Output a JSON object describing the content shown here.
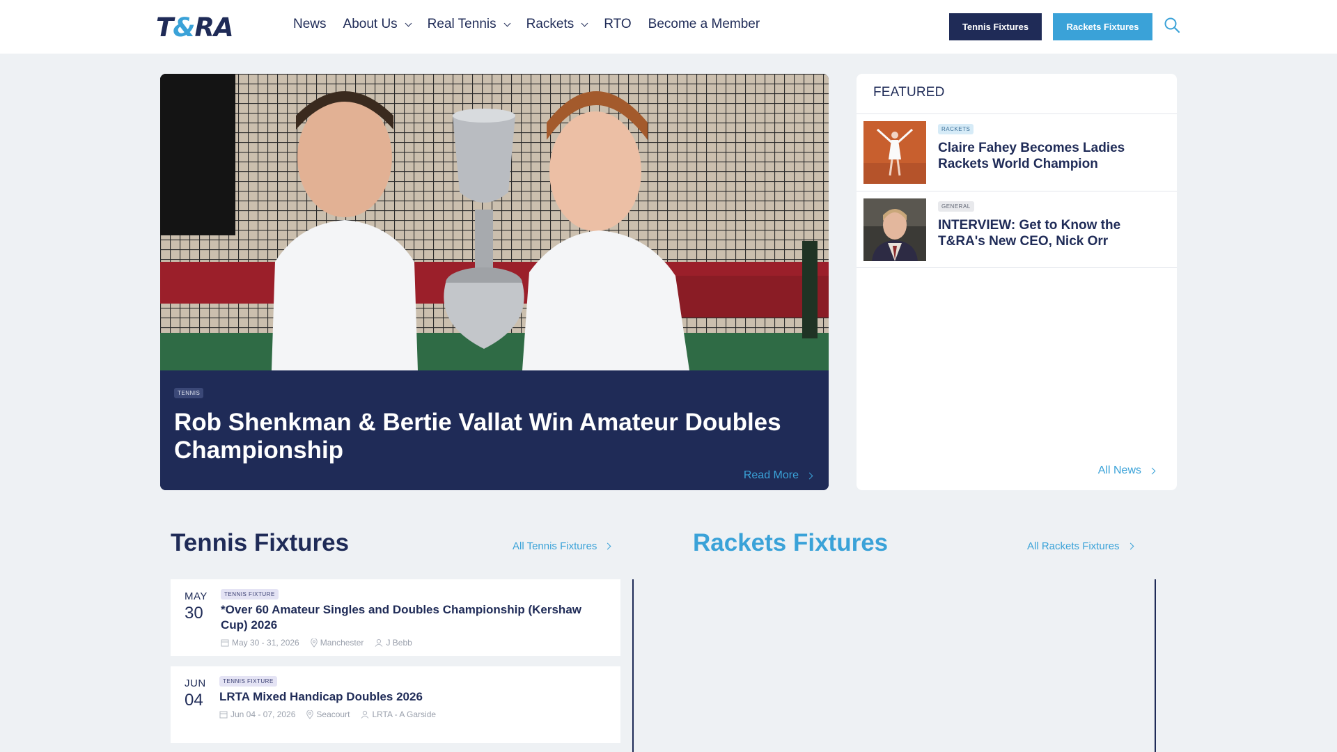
{
  "header": {
    "logo": {
      "part1": "T",
      "amp": "&",
      "part2": "RA"
    },
    "nav": [
      {
        "label": "News",
        "dropdown": false
      },
      {
        "label": "About Us",
        "dropdown": true
      },
      {
        "label": "Real Tennis",
        "dropdown": true
      },
      {
        "label": "Rackets",
        "dropdown": true
      },
      {
        "label": "RTO",
        "dropdown": false
      },
      {
        "label": "Become a Member",
        "dropdown": false
      }
    ],
    "tennis_fixtures_button": "Tennis Fixtures",
    "rackets_fixtures_button": "Rackets Fixtures",
    "search_icon": "search-icon"
  },
  "hero": {
    "tag": "TENNIS",
    "title": "Rob Shenkman & Bertie Vallat Win Amateur Doubles Championship",
    "read_more": "Read More"
  },
  "featured": {
    "title": "FEATURED",
    "items": [
      {
        "tag": "RACKETS",
        "headline": "Claire Fahey Becomes Ladies Rackets World Champion"
      },
      {
        "tag": "GENERAL",
        "headline": "INTERVIEW: Get to Know the T&RA's New CEO, Nick Orr"
      }
    ],
    "all_news": "All News"
  },
  "tennis_fixtures": {
    "title": "Tennis Fixtures",
    "all_link": "All Tennis Fixtures",
    "items": [
      {
        "month": "MAY",
        "day": "30",
        "tag": "TENNIS FIXTURE",
        "title": "*Over 60 Amateur Singles and Doubles Championship (Kershaw Cup) 2026",
        "dates": "May 30 - 31, 2026",
        "venue": "Manchester",
        "organiser": "J Bebb"
      },
      {
        "month": "JUN",
        "day": "04",
        "tag": "TENNIS FIXTURE",
        "title": "LRTA Mixed Handicap Doubles 2026",
        "dates": "Jun 04 - 07, 2026",
        "venue": "Seacourt",
        "organiser": "LRTA - A Garside"
      }
    ]
  },
  "rackets_fixtures": {
    "title": "Rackets Fixtures",
    "all_link": "All Rackets Fixtures"
  },
  "colors": {
    "navy": "#1f2b57",
    "accent": "#3aa2d8",
    "background": "#eef1f4"
  }
}
